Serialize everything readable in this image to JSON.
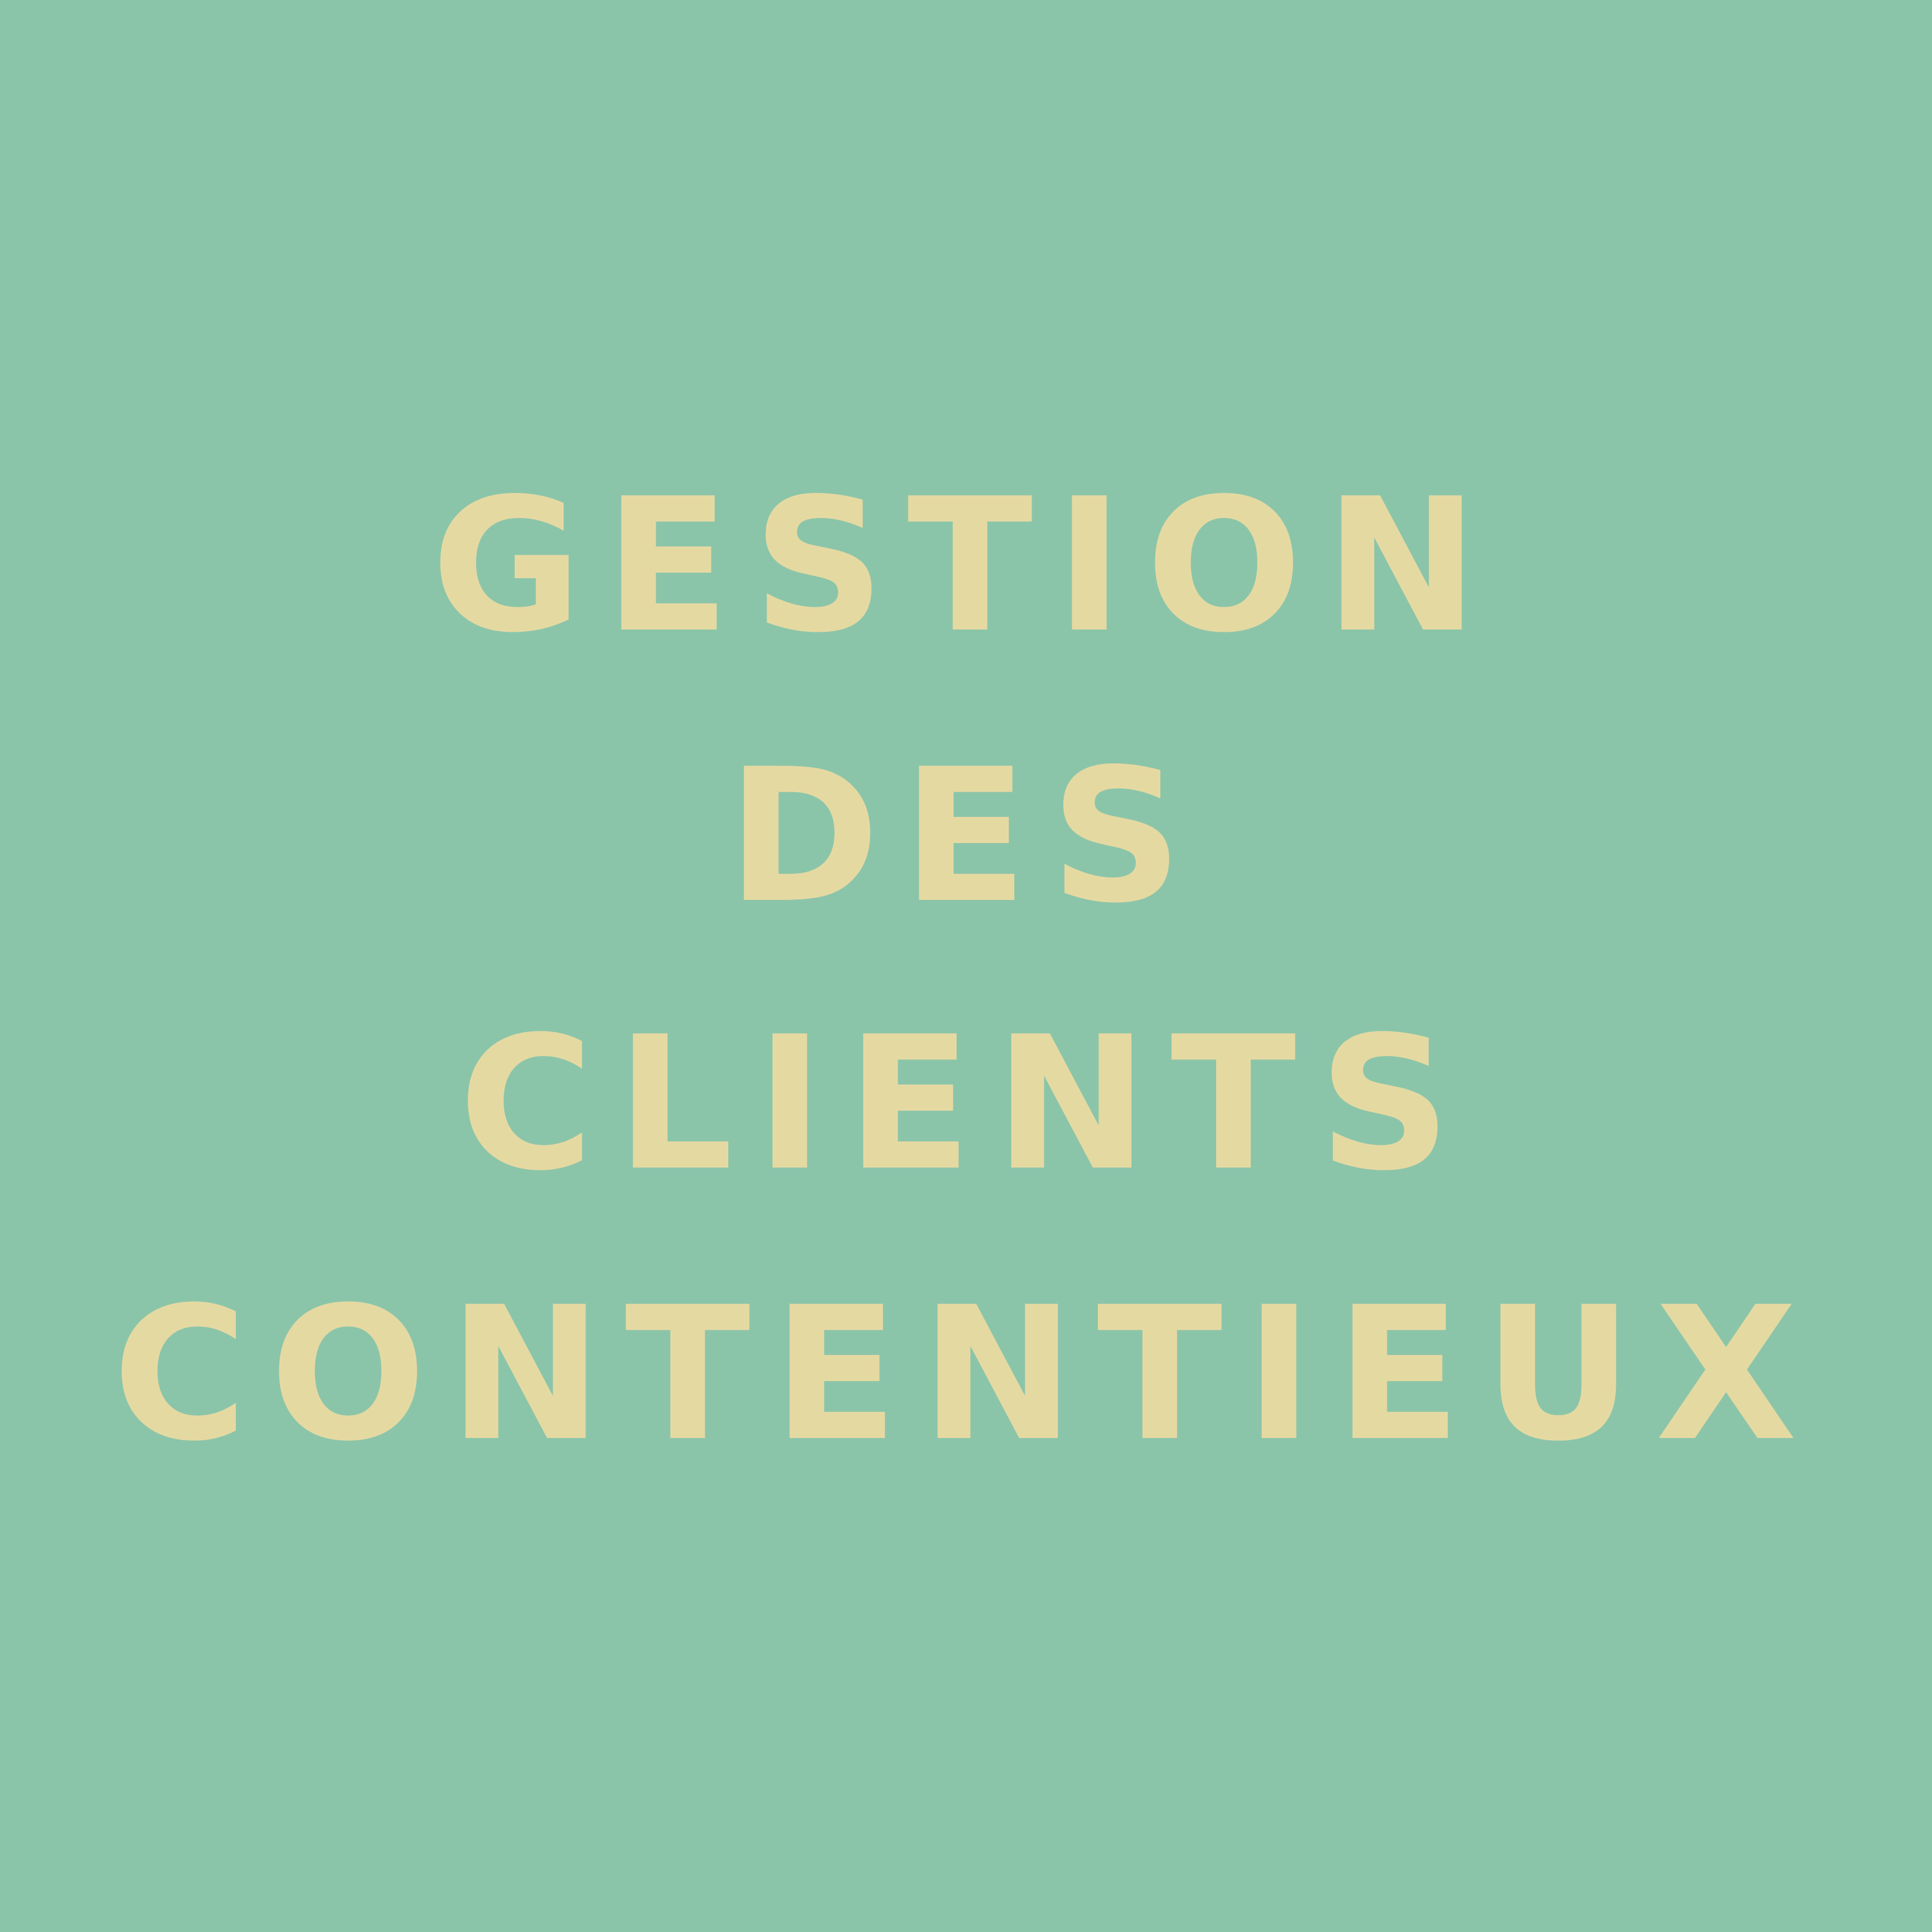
{
  "background_color": "#8bc5a9",
  "text_color": "#e5d9a2",
  "title_lines": [
    "GESTION",
    "DES",
    "CLIENTS",
    "CONTENTIEUX"
  ]
}
